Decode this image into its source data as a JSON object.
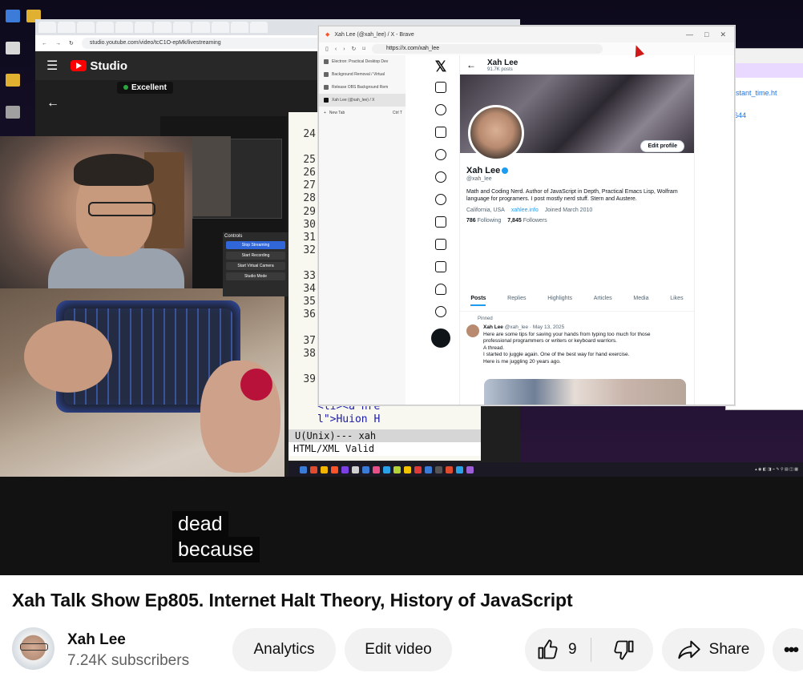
{
  "video": {
    "captions": [
      "dead",
      "because"
    ],
    "screen": {
      "studio": {
        "logo": "Studio",
        "url": "studio.youtube.com/video/tcC1O-epMk/livestreaming",
        "stream_health": "Excellent",
        "controls_title": "Controls",
        "controls": [
          "Stop Streaming",
          "Start Recording",
          "Start Virtual Camera",
          "Studio Mode"
        ]
      },
      "emacs": {
        "line_numbers": [
          "24",
          "",
          "25",
          "26",
          "27",
          "28",
          "29",
          "30",
          "31",
          "32",
          "",
          "33",
          "34",
          "35",
          "36",
          "",
          "37",
          "38",
          "",
          "39"
        ],
        "code_lines": [
          "<li><a hre",
          "l\">Huion H"
        ],
        "mode_line": "U(Unix)--- xah",
        "minibuffer": "HTML/XML Valid"
      },
      "brave": {
        "window_title": "Xah Lee (@xah_lee) / X - Brave",
        "address": "https://x.com/xah_lee",
        "side_tabs": [
          "Electron: Practical Desktop Dev",
          "Background Removal / Virtual",
          "Release OBS Background Rem",
          "Xah Lee (@xah_lee) / X"
        ],
        "new_tab": "New Tab",
        "new_tab_shortcut": "Ctrl T"
      },
      "x_profile": {
        "header_name": "Xah Lee",
        "posts_count": "91.7K posts",
        "edit_profile": "Edit profile",
        "name": "Xah Lee",
        "handle": "@xah_lee",
        "bio": "Math and Coding Nerd. Author of JavaScript in Depth, Practical Emacs Lisp, Wolfram language for programers. I post mostly nerd stuff. Stern and Austere.",
        "location": "California, USA",
        "website": "xahlee.info",
        "joined": "Joined March 2010",
        "following_count": "786",
        "following_label": "Following",
        "followers_count": "7,845",
        "followers_label": "Followers",
        "tabs": [
          "Posts",
          "Replies",
          "Highlights",
          "Articles",
          "Media",
          "Likes"
        ],
        "pinned_label": "Pinned",
        "post_author": "Xah Lee",
        "post_meta": "@xah_lee · May 13, 2025",
        "post_text_lines": [
          "Here are some tips for saving your hands from typing too much for those",
          "professional programmers or writers or keyboard warriors.",
          "A thread.",
          "I started to juggle again. One of the best way for hand exercise.",
          "Here is me juggling 20 years ago."
        ]
      },
      "right_window": {
        "link_lines": [
          "istant_time.ht",
          "644"
        ]
      }
    }
  },
  "title": "Xah Talk Show Ep805. Internet Halt Theory, History of JavaScript",
  "channel": {
    "name": "Xah Lee",
    "subscribers": "7.24K subscribers"
  },
  "actions": {
    "analytics": "Analytics",
    "edit_video": "Edit video",
    "like_count": "9",
    "share": "Share"
  },
  "colors": {
    "youtube_red": "#ff0000",
    "button_bg": "#f2f2f2",
    "x_blue": "#1d9bf0"
  }
}
